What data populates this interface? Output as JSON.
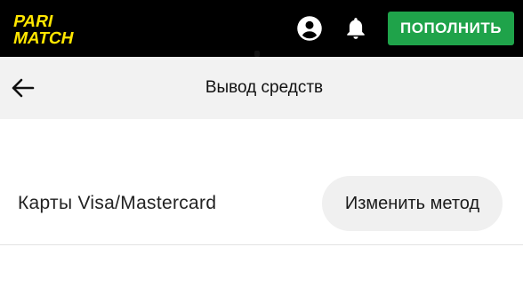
{
  "header": {
    "logo": {
      "line1": "PARI",
      "line2": "MATCH",
      "accent_color": "#ffe600",
      "icon": "parimatch-logo-icon"
    },
    "account_icon": "account-circle-icon",
    "notifications_icon": "bell-icon",
    "topup_label": "ПОПОЛНИТЬ",
    "topup_color": "#1fa34a"
  },
  "subheader": {
    "back_icon": "arrow-left-icon",
    "title": "Вывод средств"
  },
  "method": {
    "name": "Карты Visa/Mastercard",
    "change_label": "Изменить метод"
  }
}
